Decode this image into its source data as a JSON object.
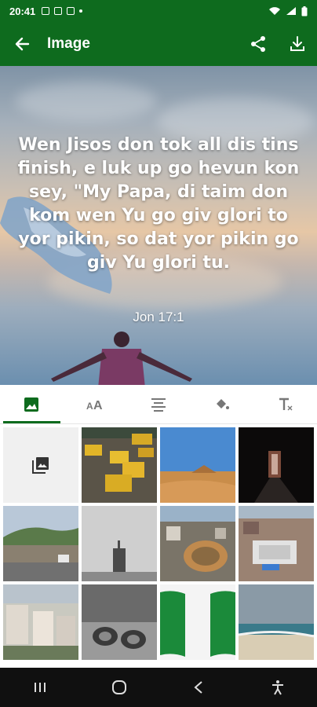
{
  "status_bar": {
    "time": "20:41"
  },
  "app_bar": {
    "title": "Image"
  },
  "preview": {
    "verse_text": "Wen Jisos don tok all dis tins finish, e luk up go hevun kon sey, \"My Papa, di taim don kom wen Yu go giv glori to yor pikin, so dat yor pikin go giv Yu glori tu.",
    "reference": "Jon 17:1"
  },
  "tabs": [
    {
      "icon": "image-icon",
      "active": true
    },
    {
      "icon": "text-size-icon",
      "active": false
    },
    {
      "icon": "align-icon",
      "active": false
    },
    {
      "icon": "fill-color-icon",
      "active": false
    },
    {
      "icon": "text-format-icon",
      "active": false
    }
  ],
  "colors": {
    "primary": "#0e6b1e",
    "nav": "#101010"
  }
}
